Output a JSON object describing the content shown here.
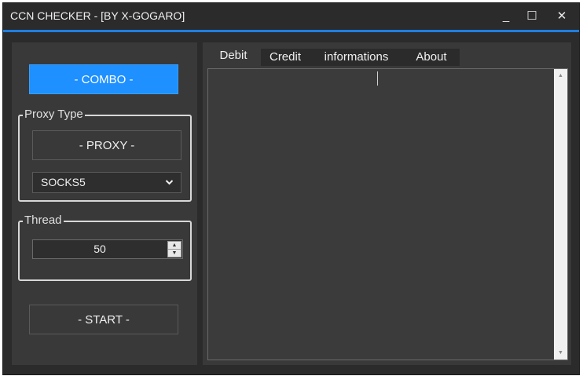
{
  "window": {
    "title": "CCN CHECKER - [BY X-GOGARO]",
    "controls": {
      "minimize": "_",
      "maximize": "☐",
      "close": "✕"
    }
  },
  "left": {
    "combo_button": "- COMBO -",
    "proxy_group": {
      "legend": "Proxy Type",
      "proxy_button": "- PROXY -",
      "proxy_type_selected": "SOCKS5"
    },
    "thread_group": {
      "legend": "Thread",
      "value": "50"
    },
    "start_button": "- START -"
  },
  "tabs": [
    {
      "label": "Debit",
      "active": true
    },
    {
      "label": "Credit",
      "active": false
    },
    {
      "label": "informations",
      "active": false
    },
    {
      "label": "About",
      "active": false
    }
  ],
  "icons": {
    "dropdown": "chevron-down-icon",
    "spin_up": "spin-up-icon",
    "spin_down": "spin-down-icon",
    "scroll_up": "scroll-up-icon",
    "scroll_down": "scroll-down-icon"
  },
  "colors": {
    "accent": "#1e90ff",
    "window_bg": "#2b2b2b",
    "panel_bg": "#393939",
    "text": "#f0f0f0"
  }
}
